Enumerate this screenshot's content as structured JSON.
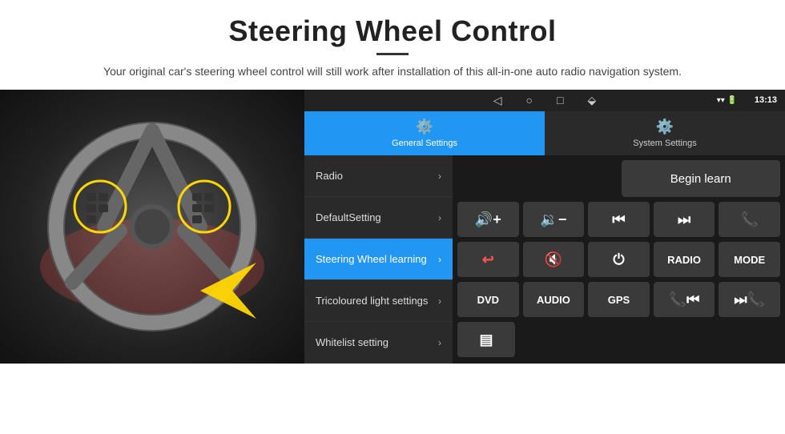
{
  "header": {
    "title": "Steering Wheel Control",
    "divider": true,
    "subtitle": "Your original car's steering wheel control will still work after installation of this all-in-one auto radio navigation system."
  },
  "statusBar": {
    "navIcons": [
      "◁",
      "○",
      "□",
      "⬙"
    ],
    "statusIcons": [
      "▾",
      "▾",
      "wifi"
    ],
    "time": "13:13"
  },
  "tabs": [
    {
      "id": "general",
      "label": "General Settings",
      "icon": "⚙",
      "active": true
    },
    {
      "id": "system",
      "label": "System Settings",
      "icon": "⚙",
      "active": false
    }
  ],
  "menu": [
    {
      "id": "radio",
      "label": "Radio",
      "active": false
    },
    {
      "id": "default",
      "label": "DefaultSetting",
      "active": false
    },
    {
      "id": "steering",
      "label": "Steering Wheel learning",
      "active": true
    },
    {
      "id": "tricoloured",
      "label": "Tricoloured light settings",
      "active": false
    },
    {
      "id": "whitelist",
      "label": "Whitelist setting",
      "active": false
    }
  ],
  "controls": {
    "beginLearnLabel": "Begin learn",
    "row1": [
      {
        "id": "vol-up",
        "icon": "🔊+",
        "label": "vol-up"
      },
      {
        "id": "vol-down",
        "icon": "🔉−",
        "label": "vol-down"
      },
      {
        "id": "prev",
        "icon": "⏮",
        "label": "prev"
      },
      {
        "id": "next",
        "icon": "⏭",
        "label": "next"
      },
      {
        "id": "phone",
        "icon": "✆",
        "label": "phone"
      }
    ],
    "row2": [
      {
        "id": "hang-up",
        "icon": "↩",
        "label": "hang-up"
      },
      {
        "id": "mute",
        "icon": "🔊×",
        "label": "mute"
      },
      {
        "id": "power",
        "icon": "⏻",
        "label": "power"
      },
      {
        "id": "radio-btn",
        "label": "RADIO",
        "text": true
      },
      {
        "id": "mode-btn",
        "label": "MODE",
        "text": true
      }
    ],
    "row3": [
      {
        "id": "dvd-btn",
        "label": "DVD",
        "text": true
      },
      {
        "id": "audio-btn",
        "label": "AUDIO",
        "text": true
      },
      {
        "id": "gps-btn",
        "label": "GPS",
        "text": true
      },
      {
        "id": "prev2",
        "icon": "📞⏮",
        "label": "prev2"
      },
      {
        "id": "next2",
        "icon": "⏭📞",
        "label": "next2"
      }
    ],
    "row4": [
      {
        "id": "eq-btn",
        "icon": "▤",
        "label": "eq"
      }
    ]
  }
}
